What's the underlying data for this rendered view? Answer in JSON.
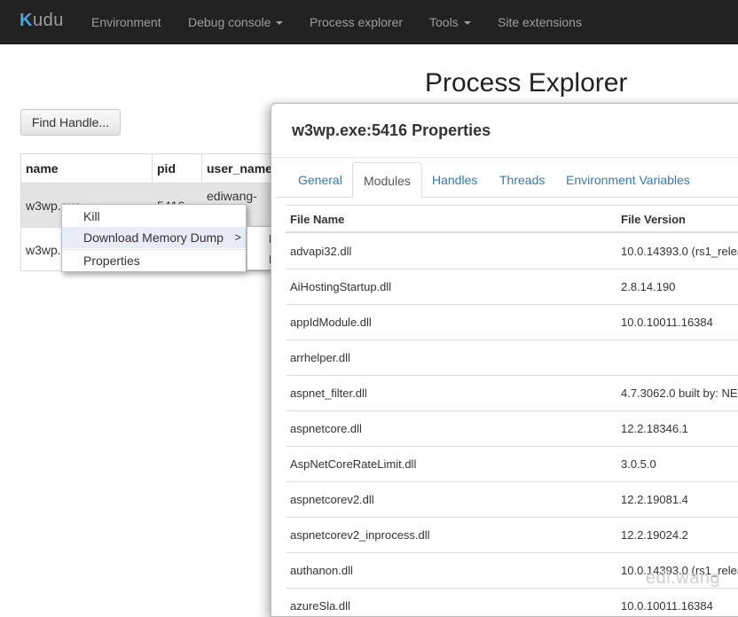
{
  "navbar": {
    "brand_k": "K",
    "brand_rest": "udu",
    "items": [
      {
        "label": "Environment"
      },
      {
        "label": "Debug console"
      },
      {
        "label": "Process explorer"
      },
      {
        "label": "Tools"
      },
      {
        "label": "Site extensions"
      }
    ]
  },
  "page": {
    "title": "Process Explorer",
    "find_handle_label": "Find Handle..."
  },
  "process_table": {
    "headers": [
      "name",
      "pid",
      "user_name"
    ],
    "rows": [
      {
        "name": "w3wp.exe",
        "pid": "5416",
        "user": "ediwang-"
      },
      {
        "name": "w3wp.",
        "pid": "",
        "user": ""
      }
    ]
  },
  "context_menu": {
    "items": [
      {
        "label": "Kill"
      },
      {
        "label": "Download Memory Dump",
        "arrow": ">"
      },
      {
        "label": "Properties"
      }
    ],
    "submenu_items": [
      "N",
      "F"
    ]
  },
  "dialog": {
    "title": "w3wp.exe:5416 Properties",
    "tabs": [
      {
        "label": "General"
      },
      {
        "label": "Modules"
      },
      {
        "label": "Handles"
      },
      {
        "label": "Threads"
      },
      {
        "label": "Environment Variables"
      }
    ],
    "active_tab": "Modules",
    "columns": [
      "File Name",
      "File Version"
    ],
    "modules": [
      {
        "file": "advapi32.dll",
        "version": "10.0.14393.0 (rs1_relea"
      },
      {
        "file": "AiHostingStartup.dll",
        "version": "2.8.14.190"
      },
      {
        "file": "appIdModule.dll",
        "version": "10.0.10011.16384"
      },
      {
        "file": "arrhelper.dll",
        "version": ""
      },
      {
        "file": "aspnet_filter.dll",
        "version": "4.7.3062.0 built by: NE"
      },
      {
        "file": "aspnetcore.dll",
        "version": "12.2.18346.1"
      },
      {
        "file": "AspNetCoreRateLimit.dll",
        "version": "3.0.5.0"
      },
      {
        "file": "aspnetcorev2.dll",
        "version": "12.2.19081.4"
      },
      {
        "file": "aspnetcorev2_inprocess.dll",
        "version": "12.2.19024.2"
      },
      {
        "file": "authanon.dll",
        "version": "10.0.14393.0 (rs1_relea"
      },
      {
        "file": "azureSla.dll",
        "version": "10.0.10011.16384"
      }
    ]
  },
  "watermark": "edi.wang"
}
